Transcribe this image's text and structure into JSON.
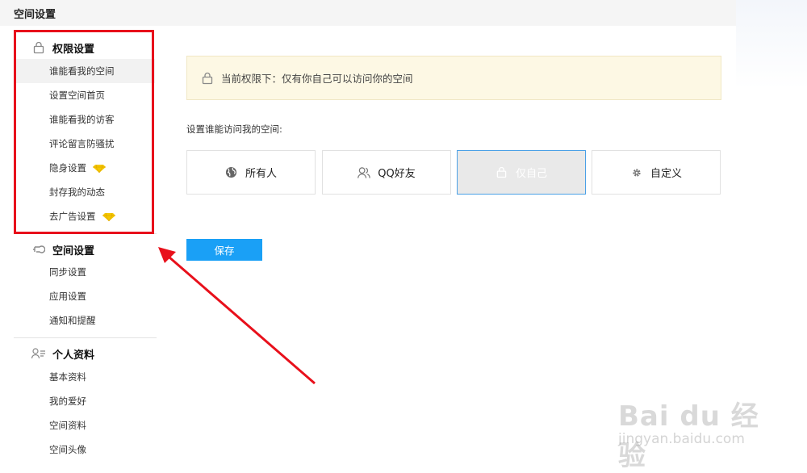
{
  "header": {
    "title": "空间设置"
  },
  "sidebar": {
    "sections": [
      {
        "title": "权限设置",
        "icon": "lock-icon",
        "items": [
          {
            "label": "谁能看我的空间",
            "active": true
          },
          {
            "label": "设置空间首页"
          },
          {
            "label": "谁能看我的访客"
          },
          {
            "label": "评论留言防骚扰"
          },
          {
            "label": "隐身设置",
            "badge": "diamond-icon"
          },
          {
            "label": "封存我的动态"
          },
          {
            "label": "去广告设置",
            "badge": "diamond-icon"
          }
        ]
      },
      {
        "title": "空间设置",
        "icon": "sync-settings-icon",
        "items": [
          {
            "label": "同步设置"
          },
          {
            "label": "应用设置"
          },
          {
            "label": "通知和提醒"
          }
        ]
      },
      {
        "title": "个人资料",
        "icon": "profile-card-icon",
        "items": [
          {
            "label": "基本资料"
          },
          {
            "label": "我的爱好"
          },
          {
            "label": "空间资料"
          },
          {
            "label": "空间头像"
          }
        ]
      }
    ]
  },
  "main": {
    "notice": "当前权限下：仅有你自己可以访问你的空间",
    "field_label": "设置谁能访问我的空间:",
    "options": [
      {
        "label": "所有人",
        "icon": "globe-icon"
      },
      {
        "label": "QQ好友",
        "icon": "friends-icon"
      },
      {
        "label": "仅自己",
        "icon": "lock-icon",
        "selected": true
      },
      {
        "label": "自定义",
        "icon": "gear-icon"
      }
    ],
    "save_label": "保存"
  },
  "watermark": {
    "logo": "Bai du 经验",
    "url": "jingyan.baidu.com"
  },
  "colors": {
    "accent": "#1aa0f6",
    "highlight": "#e8101b",
    "notice_bg": "#fdf8e4",
    "badge": "#f5c800"
  }
}
